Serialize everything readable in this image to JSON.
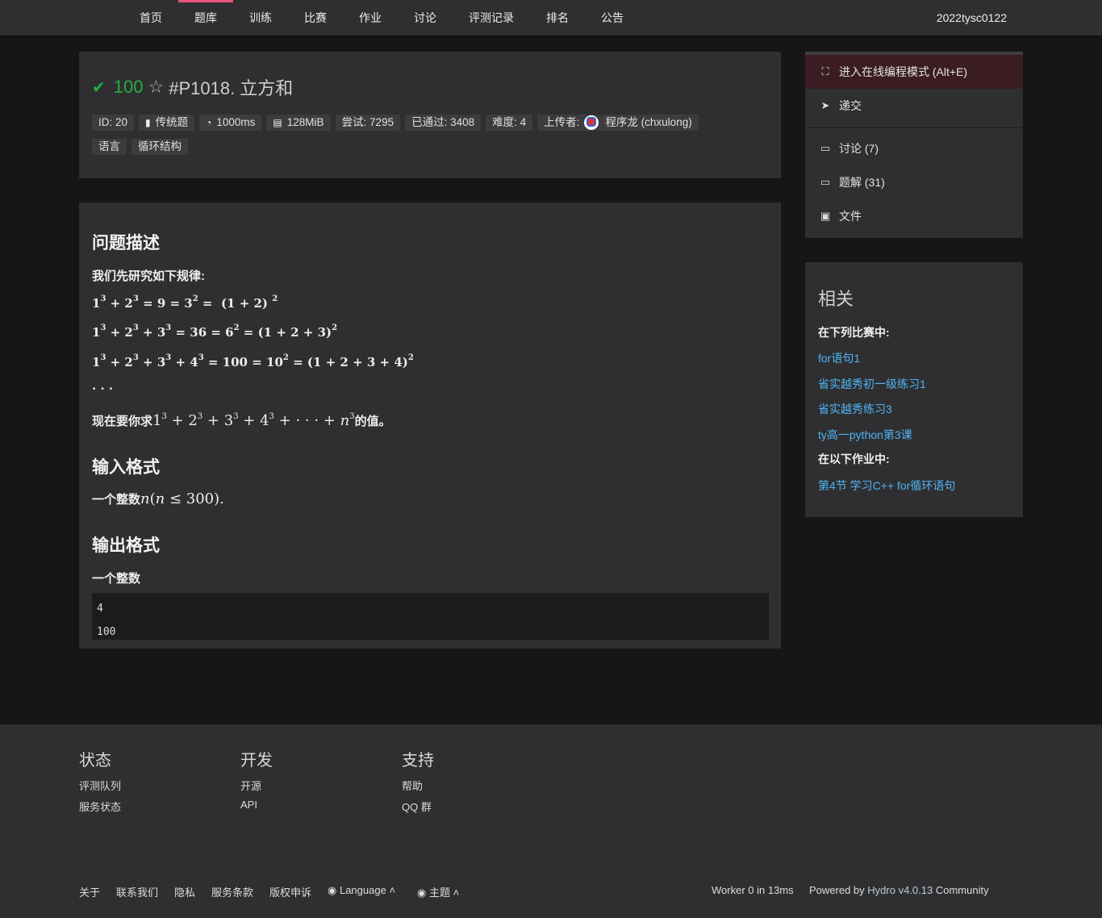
{
  "nav": {
    "items": [
      "首页",
      "题库",
      "训练",
      "比赛",
      "作业",
      "讨论",
      "评测记录",
      "排名",
      "公告"
    ],
    "active": "题库",
    "user": "2022tysc0122"
  },
  "problem": {
    "score": "100",
    "title": "#P1018. 立方和",
    "meta": {
      "id": "ID: 20",
      "type": "传统题",
      "time": "1000ms",
      "memory": "128MiB",
      "tried": "尝试: 7295",
      "passed": "已通过: 3408",
      "difficulty": "难度: 4",
      "uploader_label": "上传者:",
      "uploader": "程序龙 (chxulong)"
    },
    "tags": [
      "语言",
      "循环结构"
    ]
  },
  "content": {
    "desc_heading": "问题描述",
    "desc_intro": "我们先研究如下规律:",
    "ellipsis": "· · ·",
    "ask_prefix": "现在要你求",
    "ask_suffix": "的值。",
    "input_heading": "输入格式",
    "input_text": "一个整数",
    "output_heading": "输出格式",
    "output_text": "一个整数",
    "sample_lines": [
      "4",
      "100"
    ]
  },
  "sidebar": {
    "primary": "进入在线编程模式 (Alt+E)",
    "submit": "递交",
    "discuss": "讨论 (7)",
    "solutions": "题解 (31)",
    "files": "文件"
  },
  "related": {
    "title": "相关",
    "contests_head": "在下列比赛中:",
    "contests": [
      "for语句1",
      "省实越秀初一级练习1",
      "省实越秀练习3",
      "ty高一python第3课"
    ],
    "homework_head": "在以下作业中:",
    "homework": [
      "第4节 学习C++ for循环语句"
    ]
  },
  "footer": {
    "columns": [
      {
        "title": "状态",
        "links": [
          "评测队列",
          "服务状态"
        ]
      },
      {
        "title": "开发",
        "links": [
          "开源",
          "API"
        ]
      },
      {
        "title": "支持",
        "links": [
          "帮助",
          "QQ 群"
        ]
      }
    ],
    "bottom_links": [
      "关于",
      "联系我们",
      "隐私",
      "服务条款",
      "版权申诉"
    ],
    "language": "Language",
    "theme": "主题",
    "worker": "Worker 0 in 13ms",
    "powered_prefix": "Powered by",
    "powered_name": "Hydro v4.0.13",
    "powered_suffix": "Community"
  },
  "colors": {
    "accent": "#e8537a",
    "success": "#25ad40",
    "link": "#4fb4f5",
    "panel": "#2f2f31",
    "background": "#161618"
  }
}
